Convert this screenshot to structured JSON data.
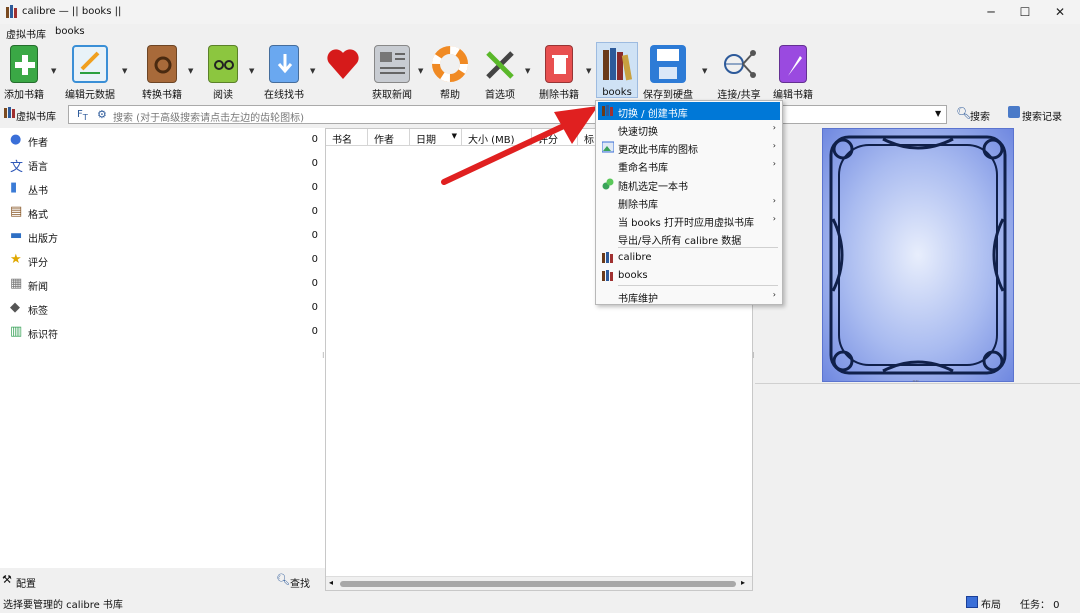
{
  "window": {
    "title": "calibre — || books ||",
    "minimize": "─",
    "maximize": "☐",
    "close": "✕"
  },
  "menubar": {
    "virtual_library": "虚拟书库",
    "library": "books"
  },
  "toolbar": {
    "add": "添加书籍",
    "edit_meta": "编辑元数据",
    "convert": "转换书籍",
    "read": "阅读",
    "find_online": "在线找书",
    "fetch_news": "获取新闻",
    "help": "帮助",
    "preferences": "首选项",
    "remove": "删除书籍",
    "library": "books",
    "save": "保存到硬盘",
    "connect": "连接/共享",
    "edit_book": "编辑书籍"
  },
  "search": {
    "vlib_label": "虚拟书库",
    "placeholder": "搜索 (对于高级搜索请点击左边的齿轮图标)",
    "search_btn": "搜索",
    "saved_btn": "搜索记录"
  },
  "tag_browser": {
    "items": [
      {
        "label": "作者",
        "count": "0",
        "icon": "person-icon",
        "color": "#3a6fd8"
      },
      {
        "label": "语言",
        "count": "0",
        "icon": "language-icon",
        "color": "#2f58b8"
      },
      {
        "label": "丛书",
        "count": "0",
        "icon": "series-icon",
        "color": "#3b7bd6"
      },
      {
        "label": "格式",
        "count": "0",
        "icon": "format-icon",
        "color": "#8a5a2a"
      },
      {
        "label": "出版方",
        "count": "0",
        "icon": "publisher-icon",
        "color": "#2e6fc4"
      },
      {
        "label": "评分",
        "count": "0",
        "icon": "star-icon",
        "color": "#e0a800"
      },
      {
        "label": "新闻",
        "count": "0",
        "icon": "news-icon",
        "color": "#777777"
      },
      {
        "label": "标签",
        "count": "0",
        "icon": "tag-icon",
        "color": "#555555"
      },
      {
        "label": "标识符",
        "count": "0",
        "icon": "identifier-icon",
        "color": "#3aa35a"
      }
    ]
  },
  "columns": [
    "书名",
    "作者",
    "日期",
    "大小 (MB)",
    "评分",
    "标"
  ],
  "library_menu": {
    "items": [
      {
        "label": "切换 / 创建书库",
        "arrow": "",
        "icon": "books-icon"
      },
      {
        "label": "快速切换",
        "arrow": "›",
        "icon": ""
      },
      {
        "label": "更改此书库的图标",
        "arrow": "›",
        "icon": "image-icon"
      },
      {
        "label": "重命名书库",
        "arrow": "›",
        "icon": ""
      },
      {
        "label": "随机选定一本书",
        "arrow": "",
        "icon": "random-icon"
      },
      {
        "label": "删除书库",
        "arrow": "›",
        "icon": ""
      },
      {
        "label": "当 books 打开时应用虚拟书库",
        "arrow": "›",
        "icon": ""
      },
      {
        "label": "导出/导入所有 calibre 数据",
        "arrow": "",
        "icon": ""
      },
      {
        "label": "calibre",
        "arrow": "",
        "icon": "books-icon"
      },
      {
        "label": "books",
        "arrow": "",
        "icon": "books-icon"
      },
      {
        "label": "书库维护",
        "arrow": "›",
        "icon": ""
      }
    ]
  },
  "bottom": {
    "configure": "配置",
    "find": "查找",
    "status": "选择要管理的 calibre 书库",
    "layout": "布局",
    "jobs": "任务： 0"
  },
  "colors": {
    "accent": "#0078d7",
    "arrow": "#e02020",
    "cover": "#7a93e6"
  }
}
